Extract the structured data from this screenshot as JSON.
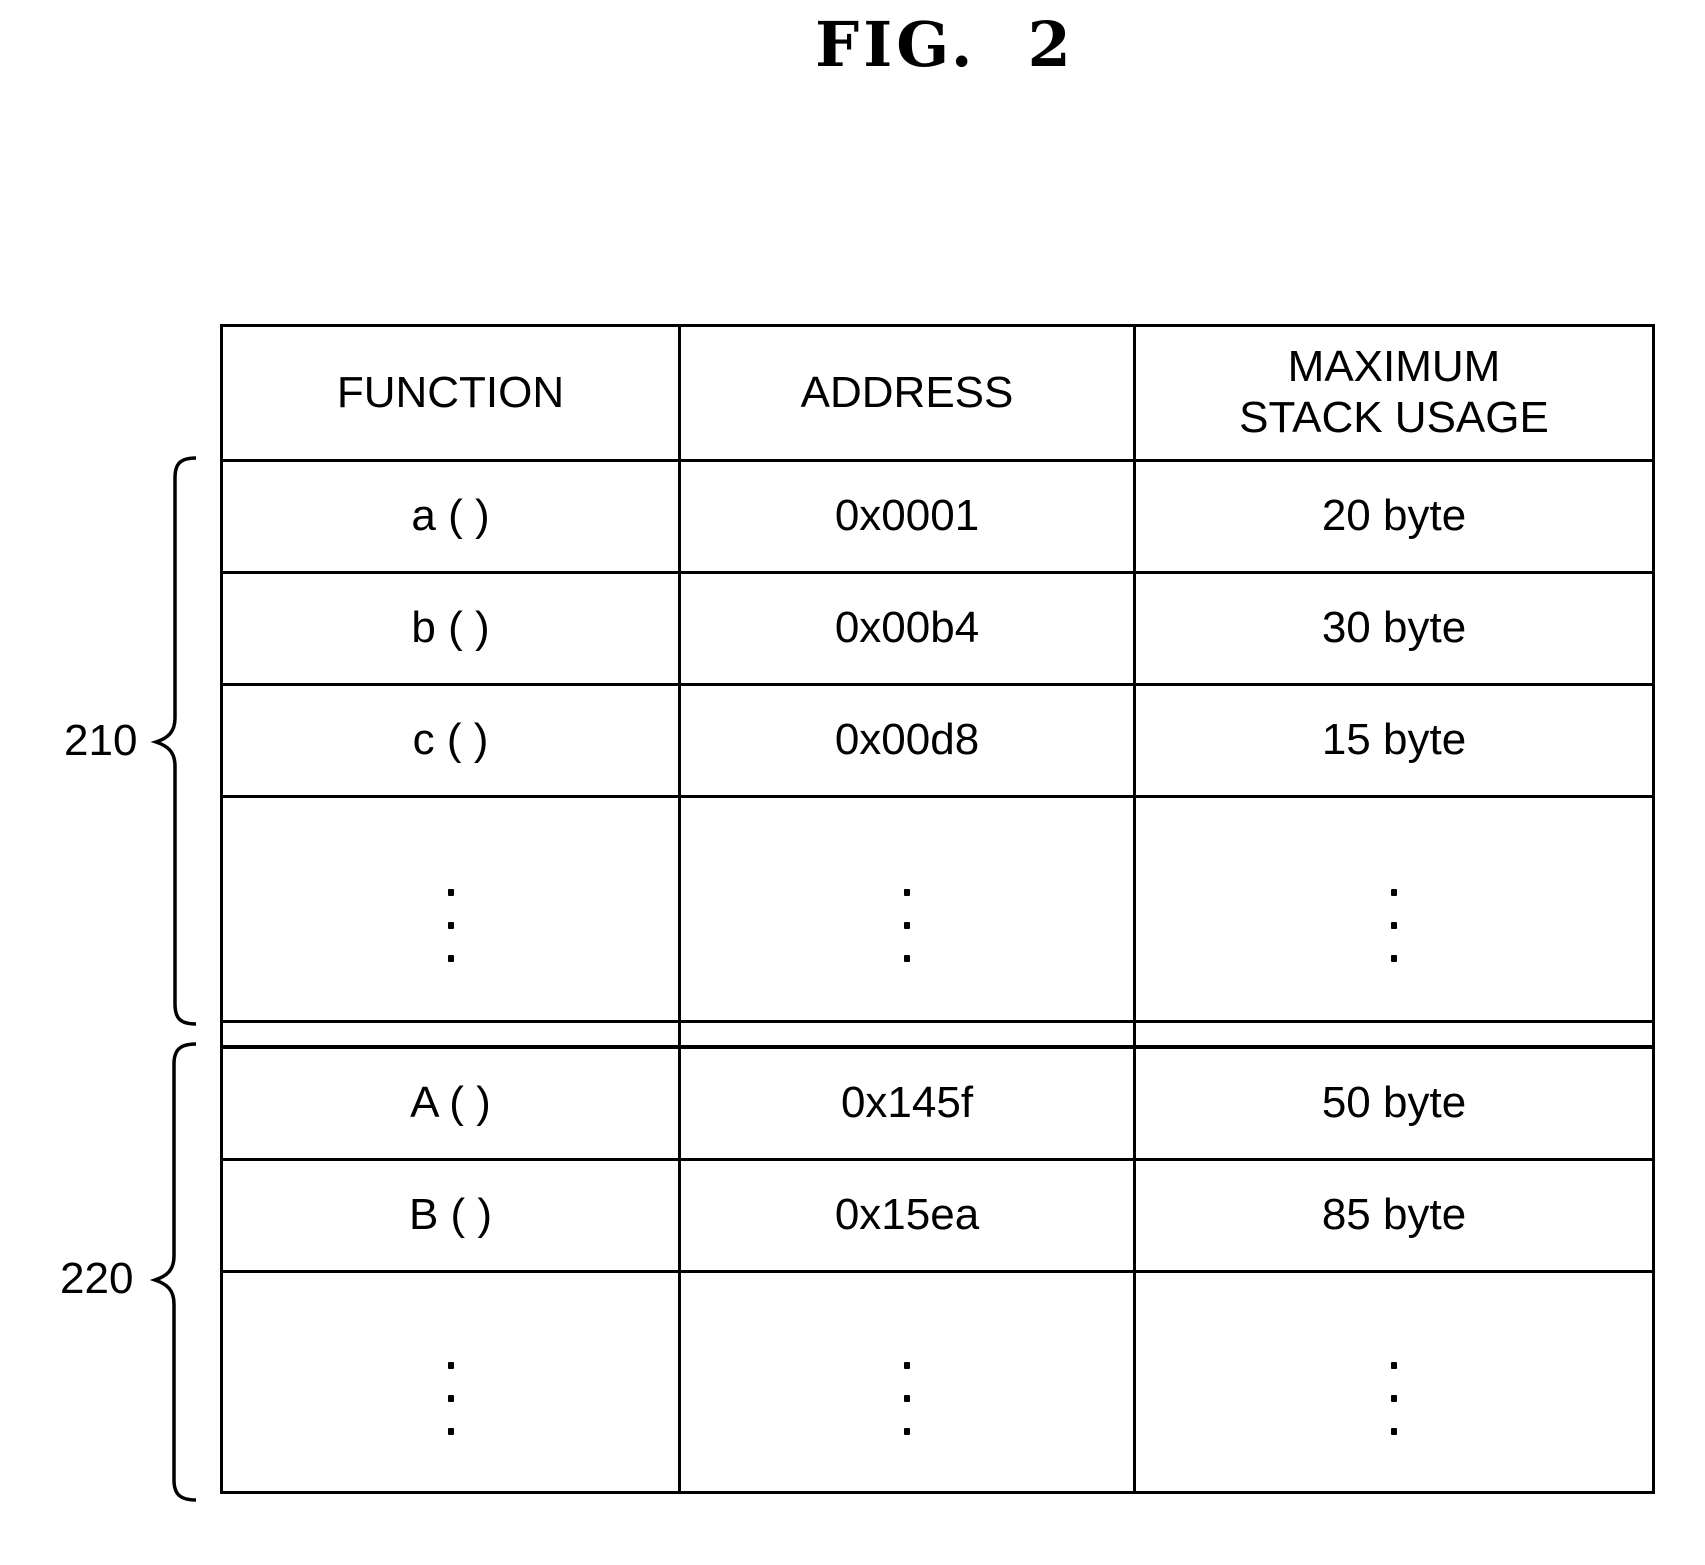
{
  "figure": {
    "title": "FIG.  2"
  },
  "table": {
    "headers": [
      "FUNCTION",
      "ADDRESS",
      "MAXIMUM STACK USAGE"
    ],
    "header_lines": {
      "function": "FUNCTION",
      "address": "ADDRESS",
      "max_line1": "MAXIMUM",
      "max_line2": "STACK USAGE"
    },
    "group_210": {
      "rows": [
        {
          "function": "a ( )",
          "address": "0x0001",
          "max_stack_usage": "20 byte"
        },
        {
          "function": "b ( )",
          "address": "0x00b4",
          "max_stack_usage": "30 byte"
        },
        {
          "function": "c ( )",
          "address": "0x00d8",
          "max_stack_usage": "15 byte"
        }
      ],
      "continuation": "⋮"
    },
    "group_220": {
      "rows": [
        {
          "function": "A ( )",
          "address": "0x145f",
          "max_stack_usage": "50 byte"
        },
        {
          "function": "B ( )",
          "address": "0x15ea",
          "max_stack_usage": "85 byte"
        }
      ],
      "continuation": "⋮"
    }
  },
  "reference_labels": {
    "group_210": "210",
    "group_220": "220"
  }
}
